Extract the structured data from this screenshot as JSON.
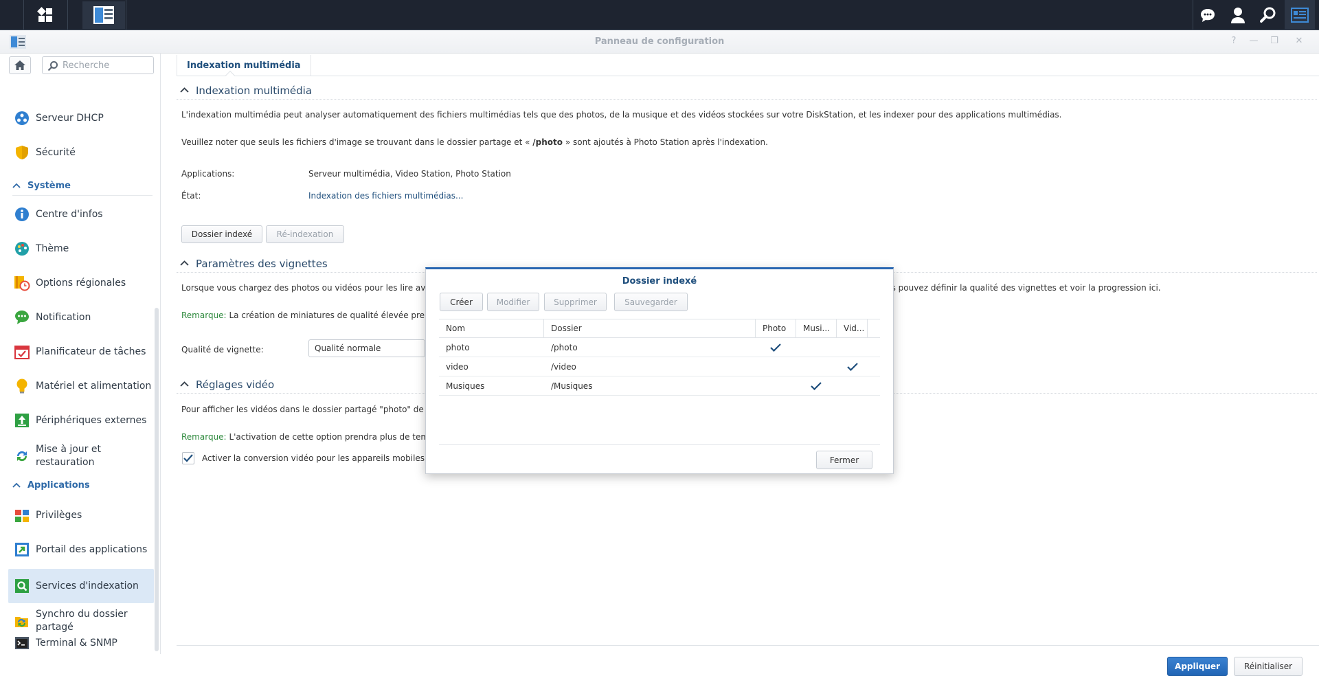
{
  "taskbar": {
    "left_icons": [
      "main-menu-icon",
      "control-panel-app-icon"
    ],
    "right_icons": [
      "chat-icon",
      "user-icon",
      "search-icon",
      "widgets-icon"
    ]
  },
  "window": {
    "title": "Panneau de configuration"
  },
  "sidebar": {
    "search_placeholder": "Recherche",
    "items": [
      {
        "label": "Serveur DHCP",
        "icon": "dhcp-icon"
      },
      {
        "label": "Sécurité",
        "icon": "shield-icon"
      },
      {
        "label": "Centre d'infos",
        "icon": "info-icon"
      },
      {
        "label": "Thème",
        "icon": "palette-icon"
      },
      {
        "label": "Options régionales",
        "icon": "regional-clock-icon"
      },
      {
        "label": "Notification",
        "icon": "notification-bubble-icon"
      },
      {
        "label": "Planificateur de tâches",
        "icon": "calendar-check-icon"
      },
      {
        "label": "Matériel et alimentation",
        "icon": "bulb-icon"
      },
      {
        "label": "Périphériques externes",
        "icon": "external-device-icon"
      },
      {
        "label": "Mise à jour et restauration",
        "icon": "update-arrows-icon"
      },
      {
        "label": "Privilèges",
        "icon": "privileges-icon"
      },
      {
        "label": "Portail des applications",
        "icon": "portal-arrow-icon"
      },
      {
        "label": "Services d'indexation",
        "icon": "indexing-search-icon"
      },
      {
        "label": "Synchro du dossier partagé",
        "icon": "folder-sync-icon"
      },
      {
        "label": "Terminal & SNMP",
        "icon": "terminal-icon"
      }
    ],
    "groups": {
      "system": "Système",
      "applications": "Applications"
    },
    "active": "Services d'indexation"
  },
  "main": {
    "tab": "Indexation multimédia",
    "sections": {
      "media": {
        "title": "Indexation multimédia",
        "desc1": "L'indexation multimédia peut analyser automatiquement des fichiers multimédias tels que des photos, de la musique et des vidéos stockées sur votre DiskStation, et les indexer pour des applications multimédias.",
        "desc2_pre": "Veuillez noter que seuls les fichiers d'image se trouvant dans le dossier partage et « ",
        "desc2_bold": "/photo",
        "desc2_post": " » sont ajoutés à Photo Station après l'indexation.",
        "apps_label": "Applications:",
        "apps_value": "Serveur multimédia, Video Station, Photo Station",
        "state_label": "État:",
        "state_value": "Indexation des fichiers multimédias...",
        "btn_indexed": "Dossier indexé",
        "btn_reindex": "Ré-indexation"
      },
      "thumbs": {
        "title": "Paramètres des vignettes",
        "desc_left": "Lorsque vous chargez des photos ou vidéos pour les lire av",
        "desc_right": "us pouvez définir la qualité des vignettes et voir la progression ici.",
        "remark_label": "Remarque:",
        "remark_text": "La création de miniatures de qualité élevée pre",
        "quality_label": "Qualité de vignette:",
        "quality_value": "Qualité normale"
      },
      "video": {
        "title": "Réglages vidéo",
        "desc": "Pour afficher les vidéos dans le dossier partagé \"photo\" de",
        "remark_label": "Remarque:",
        "remark_text": "L'activation de cette option prendra plus de tem",
        "checkbox_label": "Activer la conversion vidéo pour les appareils mobiles",
        "checkbox_checked": true
      }
    },
    "footer": {
      "apply": "Appliquer",
      "reset": "Réinitialiser"
    }
  },
  "modal": {
    "title": "Dossier indexé",
    "buttons": {
      "create": "Créer",
      "edit": "Modifier",
      "delete": "Supprimer",
      "save": "Sauvegarder"
    },
    "columns": [
      "Nom",
      "Dossier",
      "Photo",
      "Musi...",
      "Vid..."
    ],
    "rows": [
      {
        "name": "photo",
        "folder": "/photo",
        "photo": true,
        "music": false,
        "video": false
      },
      {
        "name": "video",
        "folder": "/video",
        "photo": false,
        "music": false,
        "video": true
      },
      {
        "name": "Musiques",
        "folder": "/Musiques",
        "photo": false,
        "music": true,
        "video": false
      }
    ],
    "close": "Fermer"
  },
  "colors": {
    "accent": "#2866b1",
    "remark": "#2f8a3e",
    "taskbar": "#1e2430",
    "active_item": "#dbe8f6"
  }
}
